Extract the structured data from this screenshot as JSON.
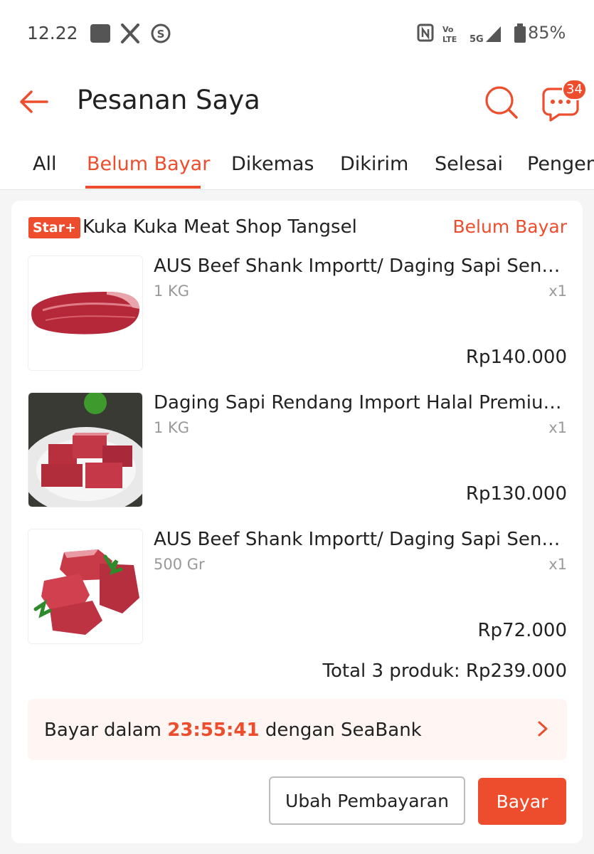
{
  "status_bar": {
    "time": "12.22",
    "battery": "85%",
    "network": "5G"
  },
  "header": {
    "title": "Pesanan Saya",
    "chat_badge": "34"
  },
  "tabs": [
    {
      "label": "All"
    },
    {
      "label": "Belum Bayar",
      "active": true
    },
    {
      "label": "Dikemas"
    },
    {
      "label": "Dikirim"
    },
    {
      "label": "Selesai"
    },
    {
      "label": "Pengem"
    }
  ],
  "order": {
    "shop_badge": "Star+",
    "shop_name": "Kuka Kuka Meat Shop Tangsel",
    "status": "Belum Bayar",
    "products": [
      {
        "name": "AUS Beef Shank Importt/ Daging Sapi Sengkel Has Paha",
        "variant": "1 KG",
        "qty": "x1",
        "price": "Rp140.000"
      },
      {
        "name": "Daging Sapi Rendang Import Halal Premium Quality",
        "variant": "1 KG",
        "qty": "x1",
        "price": "Rp130.000"
      },
      {
        "name": "AUS Beef Shank Importt/ Daging Sapi Sengkel Has Paha",
        "variant": "500 Gr",
        "qty": "x1",
        "price": "Rp72.000"
      }
    ],
    "total": "Total 3 produk: Rp239.000",
    "payment": {
      "prefix": "Bayar dalam",
      "countdown": "23:55:41",
      "suffix": "dengan SeaBank"
    },
    "buttons": {
      "change_payment": "Ubah Pembayaran",
      "pay": "Bayar"
    }
  },
  "colors": {
    "accent": "#ee4d2d",
    "muted": "#999999",
    "background": "#f5f5f5"
  }
}
